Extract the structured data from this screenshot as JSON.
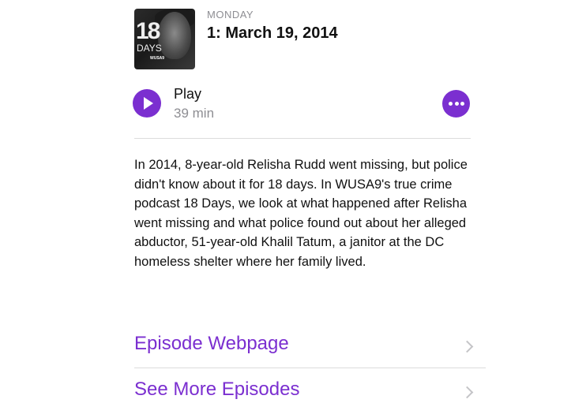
{
  "episode": {
    "day": "MONDAY",
    "title": "1: March 19, 2014",
    "artwork": {
      "number": "18",
      "word": "DAYS",
      "brand": "WUSA9"
    }
  },
  "player": {
    "play_label": "Play",
    "duration": "39 min",
    "icons": {
      "play": "play-icon",
      "more": "more-icon"
    },
    "accent_color": "#7b2fd0"
  },
  "description": "In 2014, 8-year-old Relisha Rudd went missing, but police didn't know about it for 18 days. In WUSA9's true crime podcast 18 Days, we look at what happened after Relisha went missing and what police found out about her alleged abductor, 51-year-old Khalil Tatum, a janitor at the DC homeless shelter where her family lived.",
  "links": [
    {
      "label": "Episode Webpage",
      "icon": "chevron-right-icon"
    },
    {
      "label": "See More Episodes",
      "icon": "chevron-right-icon"
    }
  ]
}
